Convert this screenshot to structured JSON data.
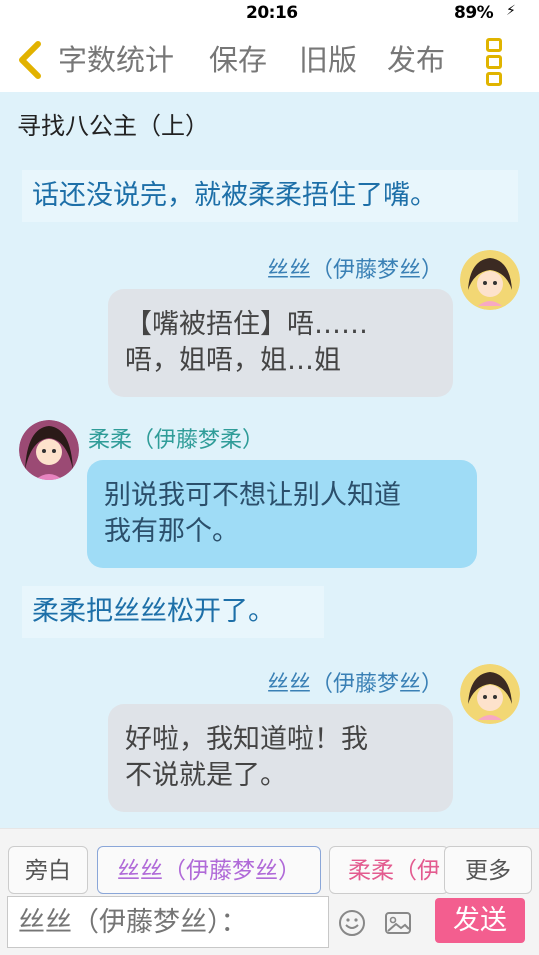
{
  "status": {
    "time": "20:16",
    "battery": "89%",
    "charge": "⚡"
  },
  "toolbar": {
    "word_count": "字数统计",
    "save": "保存",
    "old_version": "旧版",
    "publish": "发布"
  },
  "chapter": {
    "title": "寻找八公主（上）"
  },
  "messages": [
    {
      "type": "narration",
      "text": "话还没说完，就被柔柔捂住了嘴。"
    },
    {
      "type": "speech",
      "speaker": "丝丝（伊藤梦丝）",
      "line1": "【嘴被捂住】唔……",
      "line2": "唔，姐唔，姐…姐"
    },
    {
      "type": "speech",
      "speaker": "柔柔（伊藤梦柔）",
      "line1": "别说我可不想让别人知道",
      "line2": "我有那个。"
    },
    {
      "type": "narration",
      "text": "柔柔把丝丝松开了。"
    },
    {
      "type": "speech",
      "speaker": "丝丝（伊藤梦丝）",
      "line1": "好啦，我知道啦！我",
      "line2": "不说就是了。"
    }
  ],
  "characters": {
    "narrator": "旁白",
    "sisi": "丝丝（伊藤梦丝）",
    "rourou": "柔柔（伊",
    "more": "更多"
  },
  "composer": {
    "placeholder": "丝丝（伊藤梦丝）：",
    "send": "发送"
  },
  "colors": {
    "send_button": "#f35e8f",
    "chat_background": "#dff2fa",
    "blue_bubble": "#9fdcf6",
    "gray_bubble": "#dfe3e8"
  }
}
